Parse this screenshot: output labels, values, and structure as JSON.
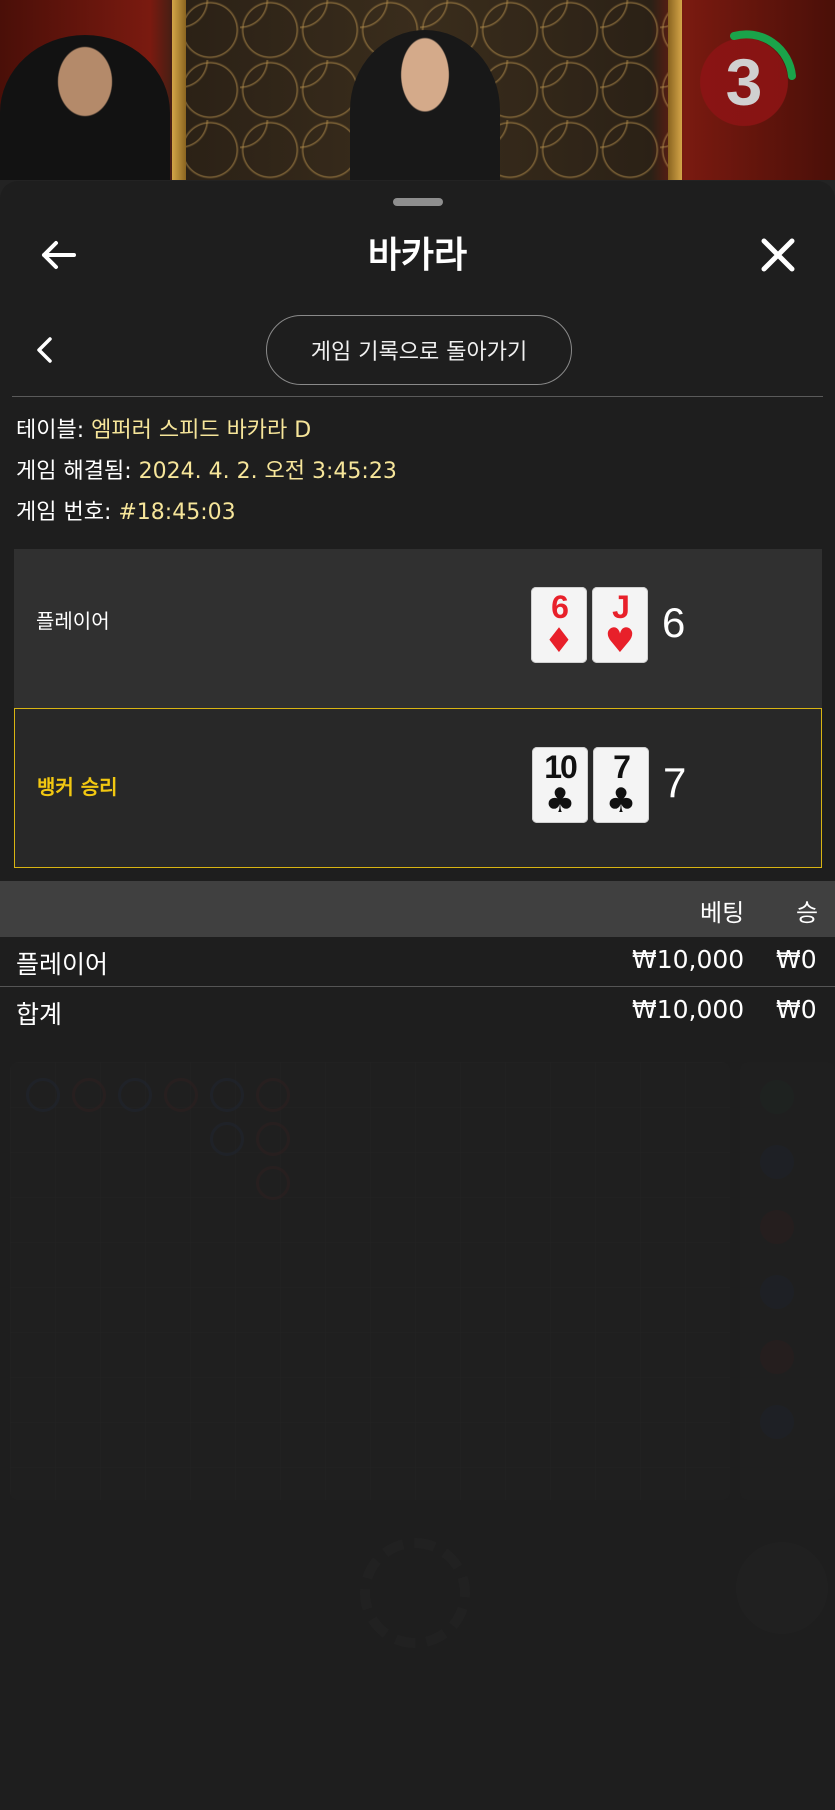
{
  "countdown": {
    "seconds": "3",
    "ring_color": "#1aa34a"
  },
  "header": {
    "title": "바카라",
    "back_icon": "arrow-left-icon",
    "close_icon": "close-icon"
  },
  "nav": {
    "prev_icon": "chevron-left-icon",
    "history_button": "게임 기록으로 돌아가기"
  },
  "info": {
    "table_label": "테이블: ",
    "table_value": "엠퍼러 스피드 바카라 D",
    "resolved_label": "게임 해결됨: ",
    "resolved_value": "2024. 4. 2. 오전 3:45:23",
    "round_label": "게임 번호: ",
    "round_value": "#18:45:03"
  },
  "hands": {
    "player": {
      "label": "플레이어",
      "cards": [
        {
          "rank": "6",
          "suit": "♦",
          "color": "red"
        },
        {
          "rank": "J",
          "suit": "♥",
          "color": "red"
        }
      ],
      "score": "6"
    },
    "banker": {
      "label": "뱅커 승리",
      "cards": [
        {
          "rank": "10",
          "suit": "♣",
          "color": "black"
        },
        {
          "rank": "7",
          "suit": "♣",
          "color": "black"
        }
      ],
      "score": "7",
      "highlight_color": "#f2c811"
    }
  },
  "bets": {
    "columns": [
      "베팅",
      "승"
    ],
    "rows": [
      {
        "name": "플레이어",
        "bet": "₩10,000",
        "win": "₩0"
      }
    ],
    "total": {
      "name": "합계",
      "bet": "₩10,000",
      "win": "₩0"
    }
  }
}
